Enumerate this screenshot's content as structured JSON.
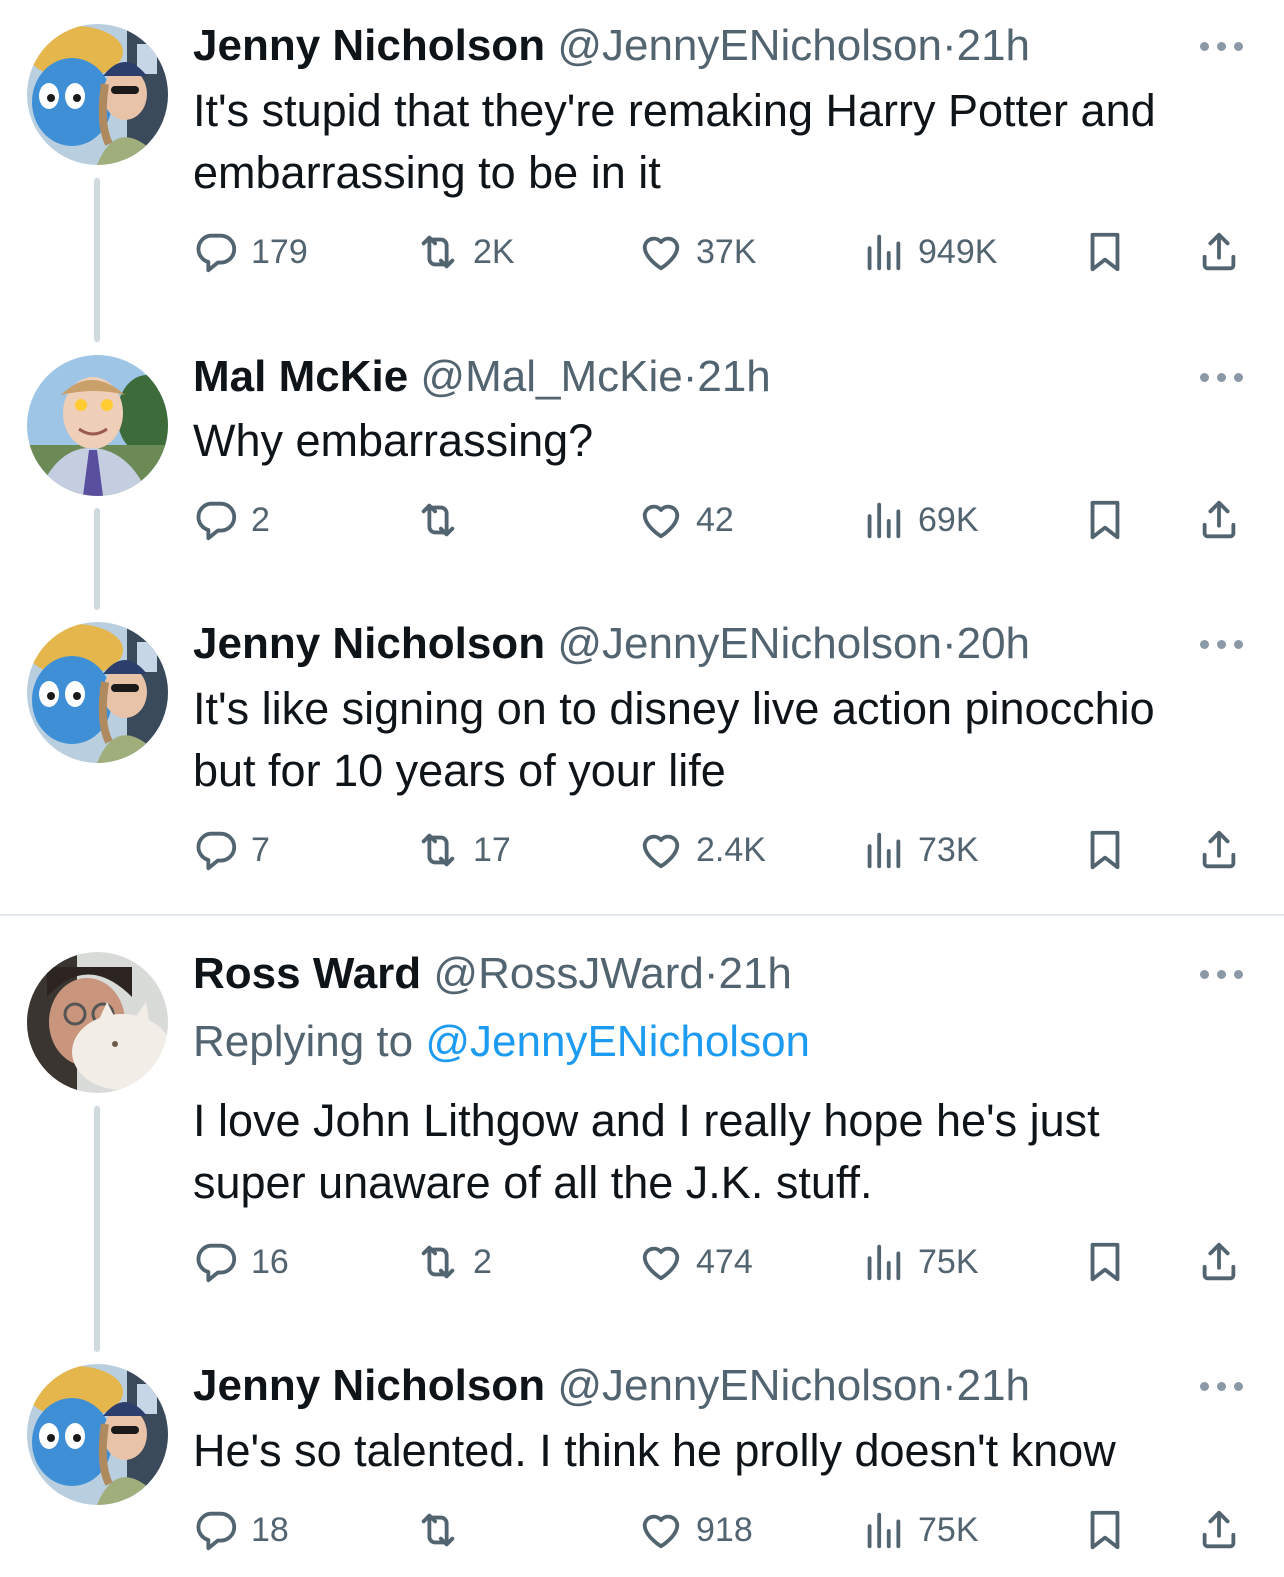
{
  "tweets": [
    {
      "name": "Jenny Nicholson",
      "handle": "@JennyENicholson",
      "dot": "·",
      "time": "21h",
      "reply_label": "",
      "reply_handle": "",
      "text_lines": [
        "It's stupid that they're remaking Harry Potter and",
        "embarrassing to be in it"
      ],
      "replies": "179",
      "retweets": "2K",
      "likes": "37K",
      "views": "949K"
    },
    {
      "name": "Mal McKie",
      "handle": "@Mal_McKie",
      "dot": "·",
      "time": "21h",
      "reply_label": "",
      "reply_handle": "",
      "text_lines": [
        "Why embarrassing?"
      ],
      "replies": "2",
      "retweets": "",
      "likes": "42",
      "views": "69K"
    },
    {
      "name": "Jenny Nicholson",
      "handle": "@JennyENicholson",
      "dot": "·",
      "time": "20h",
      "reply_label": "",
      "reply_handle": "",
      "text_lines": [
        "It's like signing on to disney live action pinocchio",
        "but for 10 years of your life"
      ],
      "replies": "7",
      "retweets": "17",
      "likes": "2.4K",
      "views": "73K"
    },
    {
      "name": "Ross Ward",
      "handle": "@RossJWard",
      "dot": "·",
      "time": "21h",
      "reply_label": "Replying to",
      "reply_handle": "@JennyENicholson",
      "text_lines": [
        "I love John Lithgow and I really hope he's just",
        "super unaware of all the J.K. stuff."
      ],
      "replies": "16",
      "retweets": "2",
      "likes": "474",
      "views": "75K"
    },
    {
      "name": "Jenny Nicholson",
      "handle": "@JennyENicholson",
      "dot": "·",
      "time": "21h",
      "reply_label": "",
      "reply_handle": "",
      "text_lines": [
        "He's so talented. I think he prolly doesn't know"
      ],
      "replies": "18",
      "retweets": "",
      "likes": "918",
      "views": "75K"
    }
  ],
  "icons": {
    "reply": "reply-icon",
    "retweet": "retweet-icon",
    "like": "heart-icon",
    "views": "views-icon",
    "bookmark": "bookmark-icon",
    "share": "share-icon",
    "more": "more-icon"
  },
  "colors": {
    "text": "#0f1419",
    "secondary": "#536471",
    "link": "#1d9bf0",
    "thread_line": "#cfd9de",
    "divider": "#e1e8ed"
  }
}
